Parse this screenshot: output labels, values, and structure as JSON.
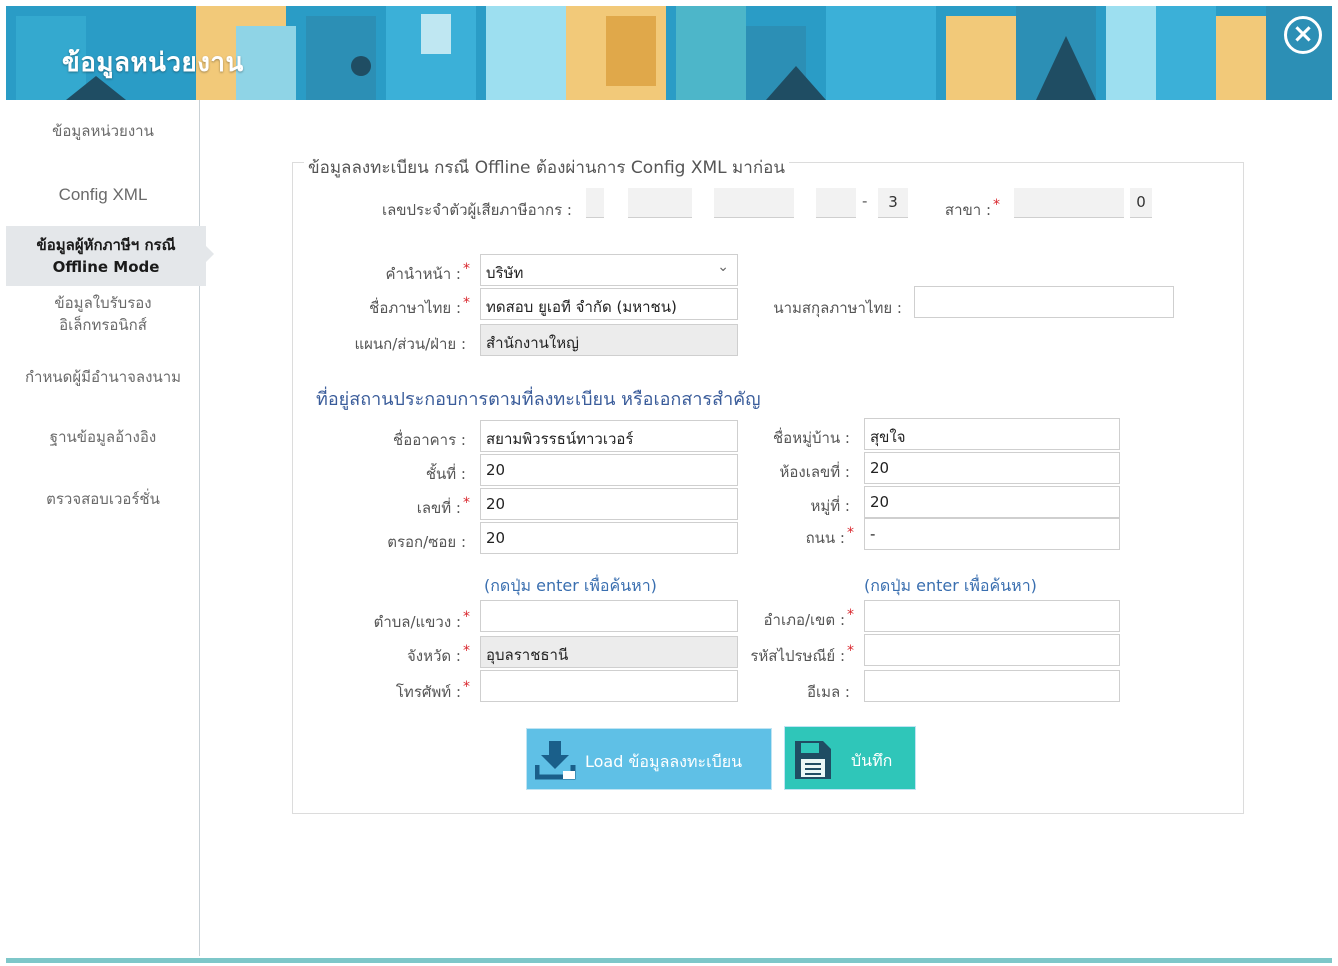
{
  "header": {
    "title": "ข้อมูลหน่วยงาน",
    "close_icon": "close-circle-icon"
  },
  "sidebar": {
    "items": [
      {
        "label": "ข้อมูลหน่วยงาน"
      },
      {
        "label": "Config XML"
      },
      {
        "label_line1": "ข้อมูลผู้หักภาษีฯ กรณี",
        "label_line2": "Offline Mode",
        "active": true
      },
      {
        "label_line1": "ข้อมูลใบรับรอง",
        "label_line2": "อิเล็กทรอนิกส์"
      },
      {
        "label": "กำหนดผู้มีอำนาจลงนาม"
      },
      {
        "label": "ฐานข้อมูลอ้างอิง"
      },
      {
        "label": "ตรวจสอบเวอร์ชั่น"
      }
    ]
  },
  "form": {
    "legend": "ข้อมูลลงทะเบียน กรณี Offline ต้องผ่านการ Config XML มาก่อน",
    "tax_id": {
      "label": "เลขประจำตัวผู้เสียภาษีอากร :",
      "last_digit": "3",
      "dash": "-"
    },
    "branch": {
      "label": "สาขา :",
      "last_digit": "0"
    },
    "title_prefix": {
      "label": "คำนำหน้า :",
      "value": "บริษัท"
    },
    "thai_name": {
      "label": "ชื่อภาษาไทย :",
      "value": "ทดสอบ ยูเอที จำกัด (มหาชน)"
    },
    "thai_surname": {
      "label": "นามสกุลภาษาไทย :",
      "value": ""
    },
    "department": {
      "label": "แผนก/ส่วน/ฝ่าย :",
      "value": "สำนักงานใหญ่"
    },
    "address_section_title": "ที่อยู่สถานประกอบการตามที่ลงทะเบียน หรือเอกสารสำคัญ",
    "building": {
      "label": "ชื่ออาคาร :",
      "value": "สยามพิวรรธน์ทาวเวอร์"
    },
    "village": {
      "label": "ชื่อหมู่บ้าน :",
      "value": "สุขใจ"
    },
    "floor": {
      "label": "ชั้นที่ :",
      "value": "20"
    },
    "room": {
      "label": "ห้องเลขที่ :",
      "value": "20"
    },
    "number": {
      "label": "เลขที่ :",
      "value": "20"
    },
    "moo": {
      "label": "หมู่ที่ :",
      "value": "20"
    },
    "soi": {
      "label": "ตรอก/ซอย :",
      "value": "20"
    },
    "road": {
      "label": "ถนน :",
      "value": "-"
    },
    "hint": "(กดปุ่ม enter เพื่อค้นหา)",
    "subdistrict": {
      "label": "ตำบล/แขวง :",
      "value": ""
    },
    "district": {
      "label": "อำเภอ/เขต :",
      "value": ""
    },
    "province": {
      "label": "จังหวัด :",
      "value": "อุบลราชธานี"
    },
    "postal": {
      "label": "รหัสไปรษณีย์ :",
      "value": ""
    },
    "phone": {
      "label": "โทรศัพท์ :",
      "value": ""
    },
    "email": {
      "label": "อีเมล :",
      "value": ""
    },
    "required_mark": "*"
  },
  "buttons": {
    "load": {
      "label": "Load ข้อมูลลงทะเบียน",
      "icon": "download-icon"
    },
    "save": {
      "label": "บันทึก",
      "icon": "floppy-disk-icon"
    }
  },
  "colors": {
    "header_bg": "#2a9cc6",
    "load_btn": "#5fc0e6",
    "save_btn": "#2fc6b9",
    "required": "#d9262d",
    "hint": "#3a6fb0"
  }
}
